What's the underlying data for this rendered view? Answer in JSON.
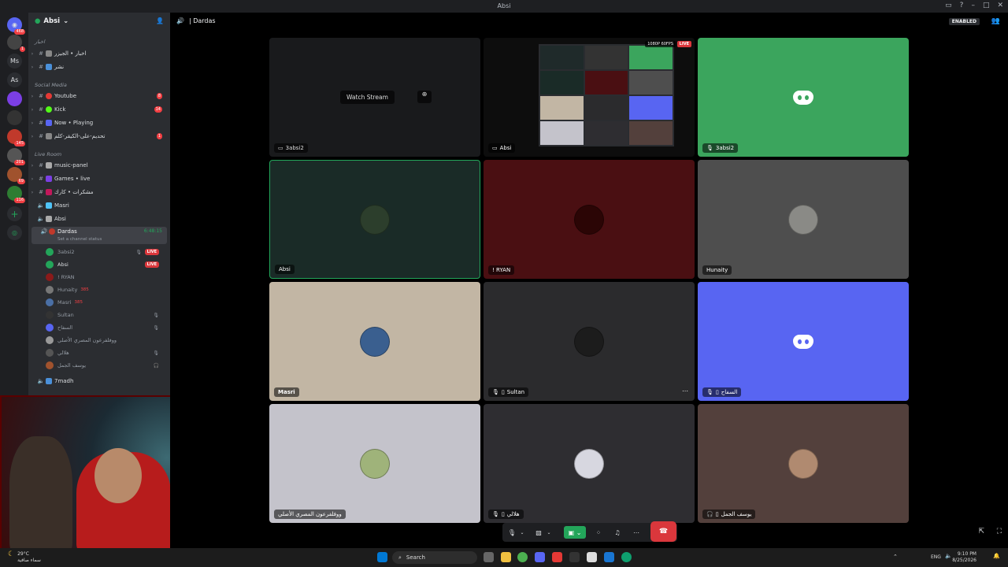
{
  "window": {
    "title": "Absi"
  },
  "servers": [
    {
      "label": "",
      "badge": "468"
    },
    {
      "label": "",
      "badge": "1"
    },
    {
      "label": "Ms",
      "badge": ""
    },
    {
      "label": "As",
      "badge": ""
    },
    {
      "label": "",
      "badge": ""
    },
    {
      "label": "",
      "badge": ""
    },
    {
      "label": "",
      "badge": "145"
    },
    {
      "label": "",
      "badge": "201"
    },
    {
      "label": "",
      "badge": "69"
    },
    {
      "label": "",
      "badge": "116"
    }
  ],
  "sidebar": {
    "guild_name": "Absi",
    "categories": {
      "news": "اخبار",
      "social": "Social Media",
      "live": "Live Room"
    },
    "channels": [
      {
        "name": "اخبار • الجيزر",
        "badge": ""
      },
      {
        "name": "نشر",
        "badge": ""
      },
      {
        "name": "Youtube",
        "badge": "8"
      },
      {
        "name": "Kick",
        "badge": "14"
      },
      {
        "name": "Now • Playing",
        "badge": ""
      },
      {
        "name": "تحديم-على-الكيقر-كلم",
        "badge": "1"
      },
      {
        "name": "music-panel",
        "badge": ""
      },
      {
        "name": "Games • live",
        "badge": ""
      },
      {
        "name": "مشكرات • كارك",
        "badge": ""
      }
    ],
    "voice_channels": {
      "masri": "Masri",
      "absi": "Absi",
      "dardas": "Dardas",
      "dardas_timer": "6:48:15",
      "dardas_status": "Set a channel status",
      "last": "7madh"
    },
    "members": [
      {
        "name": "3absi2",
        "live": "LIVE",
        "color": "#23a55a"
      },
      {
        "name": "Absi",
        "live": "LIVE",
        "color": "#23a55a"
      },
      {
        "name": "! RYAN",
        "live": "",
        "color": "#8b1a1a"
      },
      {
        "name": "Hunaity",
        "live": "",
        "tag": "385",
        "color": "#777"
      },
      {
        "name": "Masri",
        "live": "",
        "tag": "385",
        "color": "#4a6fa5"
      },
      {
        "name": "Sultan",
        "live": "",
        "color": "#333"
      },
      {
        "name": "السفاح",
        "live": "",
        "color": "#5865f2"
      },
      {
        "name": "ووفلفرعون المصري الأصلي",
        "live": "",
        "color": "#999"
      },
      {
        "name": "هلالي",
        "live": "",
        "color": "#555"
      },
      {
        "name": "يوسف الجمل",
        "live": "",
        "color": "#a0522d"
      }
    ]
  },
  "call": {
    "channel": "| Dardas",
    "enabled_label": "ENABLED",
    "tiles": [
      {
        "label": "3absi2",
        "overlay": "Watch Stream",
        "color": "#1e1f22"
      },
      {
        "label": "Absi",
        "quality": "1080P 60FPS",
        "live": "LIVE",
        "color": "#0d0d0d"
      },
      {
        "label": "3absi2",
        "color": "#3ba55d"
      },
      {
        "label": "Absi",
        "color": "#1a2b27"
      },
      {
        "label": "! RYAN",
        "color": "#4a0f12"
      },
      {
        "label": "Hunaity",
        "color": "#4e4e4e"
      },
      {
        "label": "Masri",
        "color": "#c2b6a4"
      },
      {
        "label": "Sultan",
        "color": "#2b2b2d"
      },
      {
        "label": "السفاح",
        "color": "#5865f2"
      },
      {
        "label": "ووفلفرعون المصري الأصلي",
        "color": "#c4c3cb"
      },
      {
        "label": "هلالي",
        "color": "#2e2d31"
      },
      {
        "label": "يوسف الجمل",
        "color": "#53403c"
      }
    ]
  },
  "taskbar": {
    "search_placeholder": "Search",
    "weather_temp": "29°C",
    "weather_desc": "سماء صافية",
    "lang": "ENG",
    "time": "9:10 PM",
    "date": "8/25/2026"
  }
}
